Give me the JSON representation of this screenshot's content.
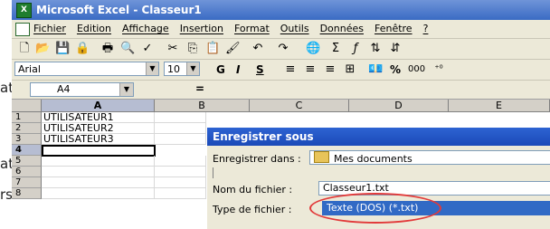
{
  "background_fragments": [
    "at",
    "at",
    "rs"
  ],
  "window": {
    "title": "Microsoft Excel - Classeur1",
    "app_icon": "excel-icon"
  },
  "menu": {
    "items": [
      "Fichier",
      "Edition",
      "Affichage",
      "Insertion",
      "Format",
      "Outils",
      "Données",
      "Fenêtre",
      "?"
    ]
  },
  "format_toolbar": {
    "font_name": "Arial",
    "font_size": "10",
    "bold": "G",
    "italic": "I",
    "underline": "S",
    "percent": "%",
    "thousands": "000"
  },
  "formula_bar": {
    "cell_ref": "A4",
    "equals": "="
  },
  "sheet": {
    "columns": [
      "A",
      "B",
      "C",
      "D",
      "E"
    ],
    "rows": [
      "1",
      "2",
      "3",
      "4",
      "5",
      "6",
      "7",
      "8"
    ],
    "cells_a": [
      "UTILISATEUR1",
      "UTILISATEUR2",
      "UTILISATEUR3",
      "",
      "",
      "",
      "",
      ""
    ],
    "active_cell": "A4"
  },
  "save_dialog": {
    "title": "Enregistrer sous",
    "save_in_label": "Enregistrer dans :",
    "save_in_value": "Mes documents",
    "filename_label": "Nom du fichier :",
    "filename_value": "Classeur1.txt",
    "filetype_label": "Type de fichier :",
    "filetype_value": "Texte (DOS) (*.txt)",
    "highlight_color": "#e23a3a"
  }
}
